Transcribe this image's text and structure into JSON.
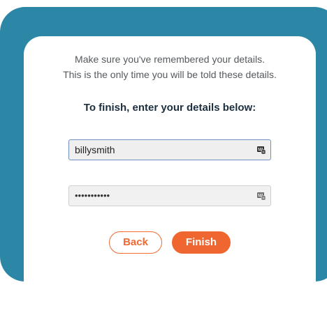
{
  "instructions": {
    "line1": "Make sure you've remembered your details.",
    "line2": "This is the only time you will be told these details."
  },
  "heading": "To finish, enter your details below:",
  "fields": {
    "username": {
      "value": "billysmith",
      "icon": "key-card-icon"
    },
    "password": {
      "value": "•••••••••••",
      "icon": "key-card-icon"
    }
  },
  "buttons": {
    "back_label": "Back",
    "finish_label": "Finish"
  },
  "colors": {
    "frame": "#2c86a6",
    "accent": "#ef6630",
    "heading": "#1b2e3f"
  }
}
